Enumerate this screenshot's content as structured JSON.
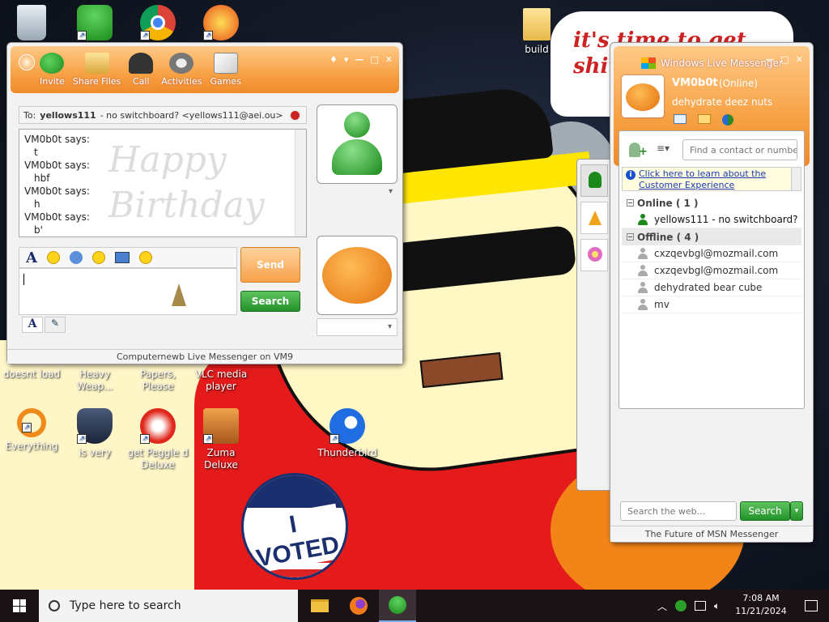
{
  "wallpaper": {
    "cloud_text": "it's time to get shit and... or t...",
    "badge_text": "I VOTED"
  },
  "desktop_icons": [
    {
      "id": "recycle",
      "label": ""
    },
    {
      "id": "msn",
      "label": ""
    },
    {
      "id": "chrome",
      "label": ""
    },
    {
      "id": "peggle-top",
      "label": ""
    },
    {
      "id": "build",
      "label": "build"
    },
    {
      "id": "doesnt-load",
      "label": "doesnt load"
    },
    {
      "id": "heavy-weapon",
      "label": "Heavy Weap..."
    },
    {
      "id": "papers-please",
      "label": "Papers, Please"
    },
    {
      "id": "vlc",
      "label": "VLC media player"
    },
    {
      "id": "everything",
      "label": "Everything"
    },
    {
      "id": "is-very",
      "label": "is very"
    },
    {
      "id": "peggle-deluxe",
      "label": "get Peggle d Deluxe"
    },
    {
      "id": "zuma",
      "label": "Zuma Deluxe"
    },
    {
      "id": "thunderbird",
      "label": "Thunderbird"
    }
  ],
  "chat_window": {
    "toolbar": [
      {
        "label": "Invite"
      },
      {
        "label": "Share Files"
      },
      {
        "label": "Call"
      },
      {
        "label": "Activities"
      },
      {
        "label": "Games"
      }
    ],
    "to_label": "To:",
    "to_name": "yellows111",
    "to_detail": "- no switchboard? <yellows111@aei.ou>",
    "messages": [
      {
        "sender": "VM0b0t says:",
        "text": "t"
      },
      {
        "sender": "VM0b0t says:",
        "text": "hbf"
      },
      {
        "sender": "VM0b0t says:",
        "text": "h"
      },
      {
        "sender": "VM0b0t says:",
        "text": "b'"
      }
    ],
    "watermark": "Happy Birthday",
    "send_label": "Send",
    "search_label": "Search",
    "footer": "Computernewb Live Messenger on VM9",
    "colors": {
      "accent": "#f7a144",
      "green": "#23922a"
    }
  },
  "contact_window": {
    "title": "Windows Live Messenger",
    "username": "VM0b0t",
    "status": "(Online)",
    "personal_message": "dehydrate deez nuts",
    "search_placeholder": "Find a contact or number...",
    "info_link": "Click here to learn about the Customer Experience",
    "groups": [
      {
        "header": "Online ( 1 )",
        "contacts": [
          {
            "name": "yellows111 - no switchboard?",
            "online": true
          }
        ]
      },
      {
        "header": "Offline ( 4 )",
        "contacts": [
          {
            "name": "cxzqevbgl@mozmail.com",
            "online": false
          },
          {
            "name": "cxzqevbgl@mozmail.com",
            "online": false
          },
          {
            "name": "dehydrated bear cube",
            "online": false
          },
          {
            "name": "mv",
            "online": false
          }
        ]
      }
    ],
    "web_search_placeholder": "Search the web...",
    "web_search_button": "Search",
    "footer": "The Future of MSN Messenger"
  },
  "taskbar": {
    "search_placeholder": "Type here to search",
    "time": "7:08 AM",
    "date": "11/21/2024"
  }
}
